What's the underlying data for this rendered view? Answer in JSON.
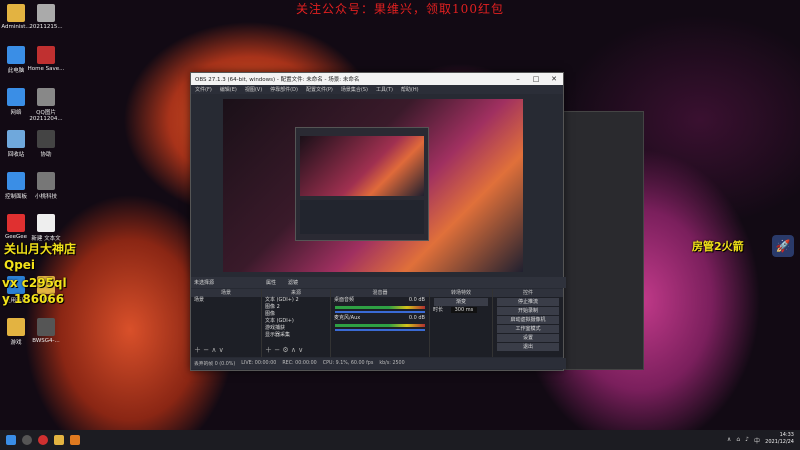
{
  "banner": "关注公众号：果维兴，领取100红包",
  "desktop_icons": [
    {
      "label": "Administ...",
      "color": "#e3b341"
    },
    {
      "label": "20211215...",
      "color": "#aaaaaa"
    },
    {
      "label": "此电脑",
      "color": "#3a8ee6"
    },
    {
      "label": "Home Save...",
      "color": "#c03030"
    },
    {
      "label": "网络",
      "color": "#3a8ee6"
    },
    {
      "label": "QQ图片20211204...",
      "color": "#888888"
    },
    {
      "label": "回收站",
      "color": "#6fa8dc"
    },
    {
      "label": "协助",
      "color": "#444444"
    },
    {
      "label": "控制面板",
      "color": "#3a8ee6"
    },
    {
      "label": "小桃科技",
      "color": "#777777"
    },
    {
      "label": "GeeGee",
      "color": "#e03030"
    },
    {
      "label": "新建 文本文",
      "color": "#eeeeee"
    },
    {
      "label": "应用商店",
      "color": "#2a7fd4"
    },
    {
      "label": "工具",
      "color": "#e3b341"
    },
    {
      "label": "游戏",
      "color": "#e3b341"
    },
    {
      "label": "BWSG4-...",
      "color": "#555555"
    }
  ],
  "overlay": {
    "line1": "关山月大神店",
    "line2": "Qpei",
    "line3": "vx c295ql",
    "line4": "y 186066",
    "right_text": "房管2火箭"
  },
  "obs": {
    "title": "OBS 27.1.3 (64-bit, windows) - 配置文件: 未命名 - 场景: 未命名",
    "menu": [
      "文件(F)",
      "编辑(E)",
      "视图(V)",
      "停靠部件(D)",
      "配置文件(P)",
      "场景集合(S)",
      "工具(T)",
      "帮助(H)"
    ],
    "strip_label": "未选择源",
    "strip_buttons": [
      "属性",
      "滤镜"
    ],
    "panels": {
      "scenes": {
        "title": "场景",
        "items": [
          "场景"
        ]
      },
      "sources": {
        "title": "来源",
        "items": [
          "文本 (GDI+) 2",
          "图像 2",
          "图像",
          "文本 (GDI+)",
          "游戏捕获",
          "显示器采集"
        ]
      },
      "mixer": {
        "title": "混音器",
        "items": [
          {
            "name": "桌面音频",
            "db": "0.0 dB"
          },
          {
            "name": "麦克风/Aux",
            "db": "0.0 dB"
          }
        ]
      },
      "transitions": {
        "title": "转场特效",
        "type": "渐变",
        "duration_label": "时长",
        "duration": "300 ms"
      },
      "controls": {
        "title": "控件",
        "buttons": [
          "停止推流",
          "开始录制",
          "启动虚拟摄像机",
          "工作室模式",
          "设置",
          "退出"
        ]
      }
    },
    "status": {
      "dropped": "丢弃的帧 0 (0.0%)",
      "live": "LIVE: 00:00:00",
      "rec": "REC: 00:00:00",
      "cpu": "CPU: 9.1%, 60.00 fps",
      "bitrate": "kb/s: 2500"
    }
  },
  "taskbar": {
    "time": "14:33",
    "date": "2021/12/24"
  }
}
